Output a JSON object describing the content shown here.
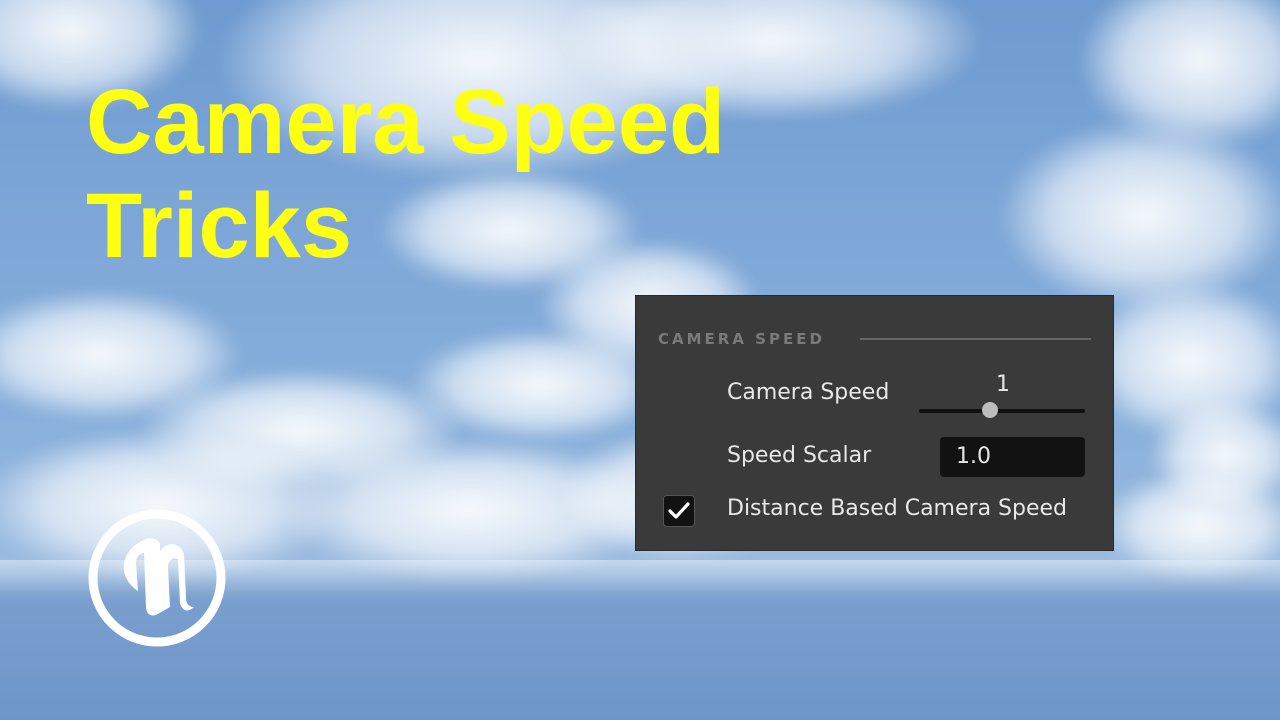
{
  "thumbnail": {
    "title_line1": "Camera Speed",
    "title_line2": "Tricks",
    "title_color": "#ffff14",
    "logo": "unreal-engine-logo"
  },
  "panel": {
    "section_title": "CAMERA SPEED",
    "camera_speed": {
      "label": "Camera Speed",
      "value": "1",
      "slider_fraction": 0.43
    },
    "speed_scalar": {
      "label": "Speed Scalar",
      "value": "1.0"
    },
    "distance_based": {
      "label": "Distance Based Camera Speed",
      "checked": true
    }
  }
}
